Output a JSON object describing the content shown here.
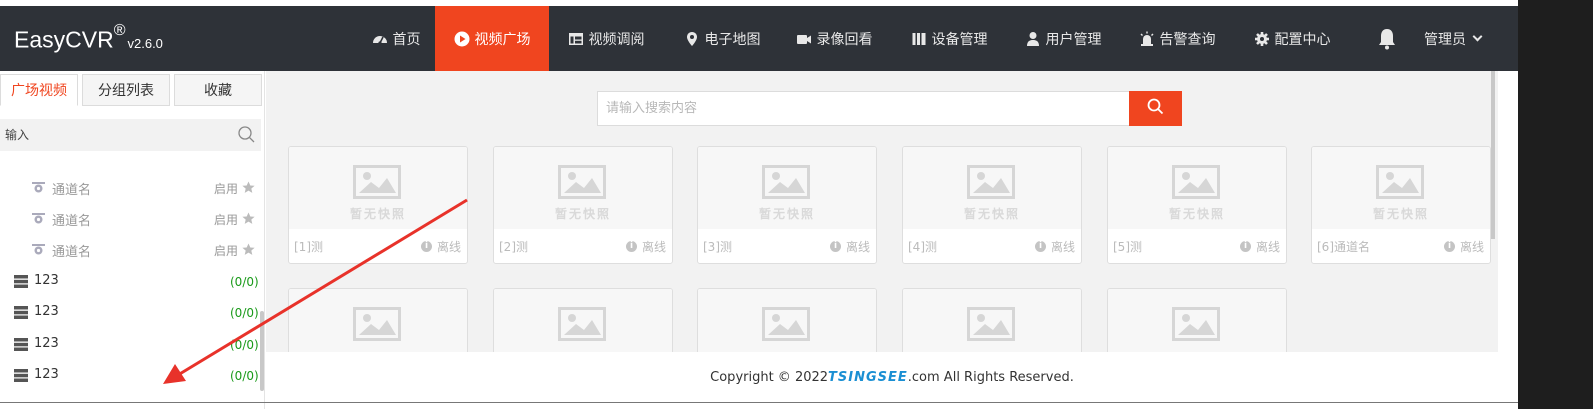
{
  "app": {
    "logo": "EasyCVR",
    "logo_mark": "®",
    "version": "v2.6.0"
  },
  "nav": [
    {
      "label": "首页",
      "icon": "dashboard-icon"
    },
    {
      "label": "视频广场",
      "icon": "play-circle-icon",
      "active": true
    },
    {
      "label": "视频调阅",
      "icon": "grid-table-icon"
    },
    {
      "label": "电子地图",
      "icon": "map-pin-icon"
    },
    {
      "label": "录像回看",
      "icon": "video-camera-icon"
    },
    {
      "label": "设备管理",
      "icon": "device-bars-icon"
    },
    {
      "label": "用户管理",
      "icon": "user-icon"
    },
    {
      "label": "告警查询",
      "icon": "alarm-light-icon"
    },
    {
      "label": "配置中心",
      "icon": "gear-icon"
    }
  ],
  "header": {
    "bell_icon": "bell-icon",
    "user_label": "管理员"
  },
  "sidebar": {
    "tabs": [
      {
        "label": "广场视频",
        "active": true
      },
      {
        "label": "分组列表"
      },
      {
        "label": "收藏"
      }
    ],
    "search_placeholder": "输入",
    "channels": [
      {
        "name": "通道名",
        "state": "启用"
      },
      {
        "name": "通道名",
        "state": "启用"
      },
      {
        "name": "通道名",
        "state": "启用"
      }
    ],
    "groups": [
      {
        "name": "123",
        "count": "(0/0)"
      },
      {
        "name": "123",
        "count": "(0/0)"
      },
      {
        "name": "123",
        "count": "(0/0)"
      },
      {
        "name": "123",
        "count": "(0/0)"
      }
    ]
  },
  "main": {
    "search_placeholder": "请输入搜索内容",
    "no_snapshot": "暂无快照",
    "cards": [
      {
        "name": "[1]测",
        "status": "离线"
      },
      {
        "name": "[2]测",
        "status": "离线"
      },
      {
        "name": "[3]测",
        "status": "离线"
      },
      {
        "name": "[4]测",
        "status": "离线"
      },
      {
        "name": "[5]测",
        "status": "离线"
      },
      {
        "name": "[6]通道名",
        "status": "离线"
      }
    ],
    "second_row_count": 5
  },
  "footer": {
    "prefix": "Copyright © 2022 ",
    "brand": "TSINGSEE",
    "suffix": ".com All Rights Reserved."
  },
  "colors": {
    "accent": "#f0451f",
    "header_bg": "#2e3238",
    "online_count": "#1a9a1a",
    "annotation_arrow": "#e8322a"
  }
}
